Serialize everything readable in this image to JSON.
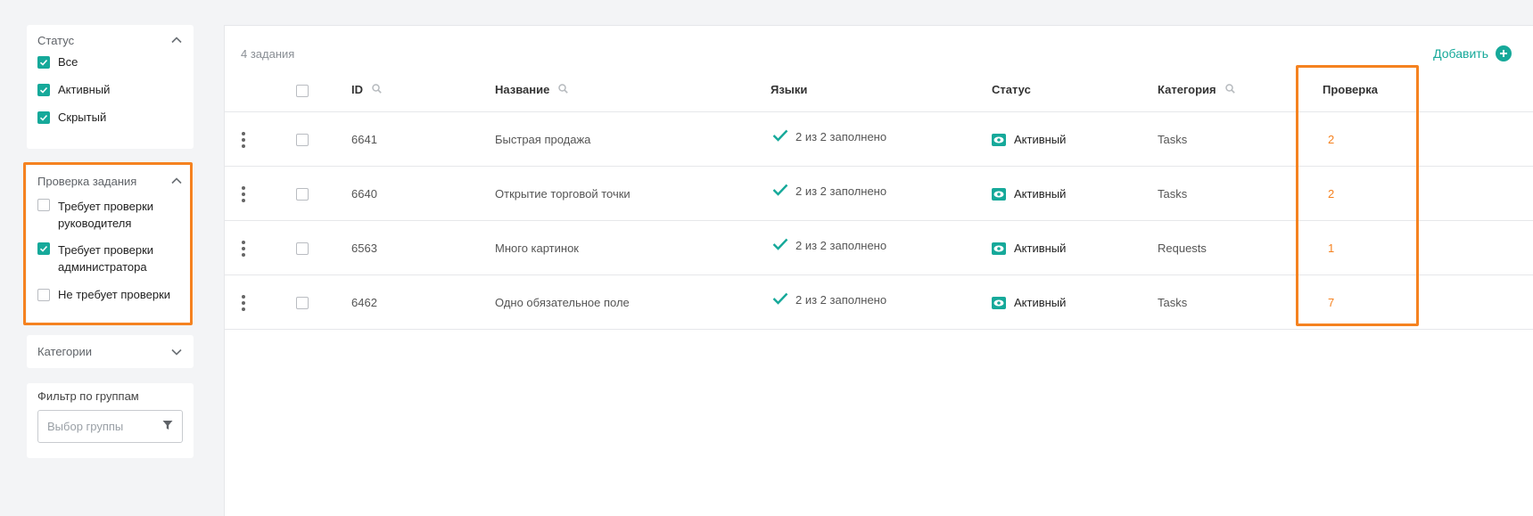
{
  "sidebar": {
    "status": {
      "title": "Статус",
      "items": [
        {
          "label": "Все",
          "checked": true
        },
        {
          "label": "Активный",
          "checked": true
        },
        {
          "label": "Скрытый",
          "checked": true
        }
      ]
    },
    "task_check": {
      "title": "Проверка задания",
      "items": [
        {
          "label_line1": "Требует проверки",
          "label_line2": "руководителя",
          "checked": false
        },
        {
          "label_line1": "Требует проверки",
          "label_line2": "администратора",
          "checked": true
        },
        {
          "label_line1": "Не требует проверки",
          "label_line2": "",
          "checked": false
        }
      ]
    },
    "categories": {
      "title": "Категории"
    },
    "groups": {
      "title": "Фильтр по группам",
      "placeholder": "Выбор группы"
    }
  },
  "main": {
    "count": "4 задания",
    "add_label": "Добавить",
    "columns": {
      "id": "ID",
      "name": "Название",
      "languages": "Языки",
      "status": "Статус",
      "category": "Категория",
      "check": "Проверка"
    },
    "rows": [
      {
        "id": "6641",
        "name": "Быстрая продажа",
        "languages": "2 из 2 заполнено",
        "status": "Активный",
        "category": "Tasks",
        "check": "2"
      },
      {
        "id": "6640",
        "name": "Открытие торговой точки",
        "languages": "2 из 2 заполнено",
        "status": "Активный",
        "category": "Tasks",
        "check": "2"
      },
      {
        "id": "6563",
        "name": "Много картинок",
        "languages": "2 из 2 заполнено",
        "status": "Активный",
        "category": "Requests",
        "check": "1"
      },
      {
        "id": "6462",
        "name": "Одно обязательное поле",
        "languages": "2 из 2 заполнено",
        "status": "Активный",
        "category": "Tasks",
        "check": "7"
      }
    ]
  },
  "colors": {
    "accent": "#16a99a",
    "highlight": "#f58220",
    "check_value": "#f58220"
  },
  "icons": {
    "collapse": "chevron-up-icon",
    "expand": "chevron-down-icon",
    "search": "search-icon",
    "filter": "filter-icon",
    "add": "plus-circle-icon",
    "row_menu": "kebab-icon",
    "filled": "checkmark-icon",
    "status": "eye-icon"
  }
}
